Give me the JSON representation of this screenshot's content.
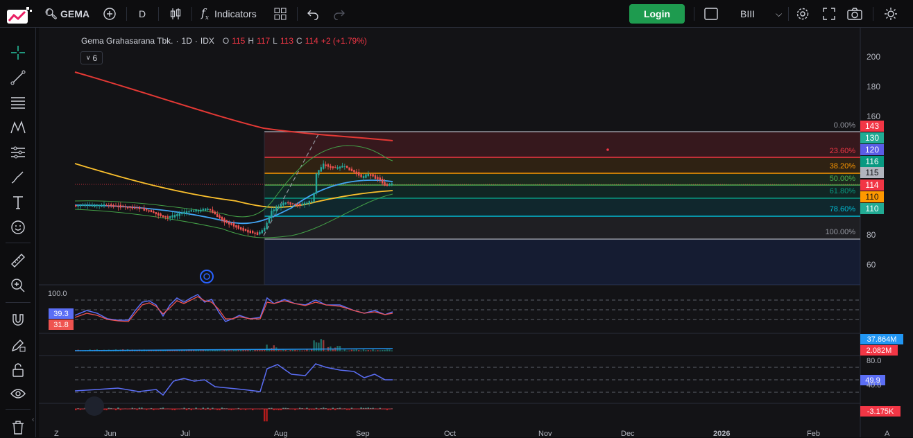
{
  "toolbar": {
    "symbol": "GEMA",
    "interval": "D",
    "indicators_label": "Indicators",
    "login_label": "Login",
    "broker_label": "BIII"
  },
  "legend": {
    "name": "Gema Grahasarana Tbk.",
    "interval": "1D",
    "exchange": "IDX",
    "o_label": "O",
    "o": "115",
    "h_label": "H",
    "h": "117",
    "l_label": "L",
    "l": "113",
    "c_label": "C",
    "c": "114",
    "change": "+2 (+1.79%)"
  },
  "indicator_count": "6",
  "price_axis": [
    "200",
    "180",
    "160",
    "80",
    "60"
  ],
  "fib_levels": [
    {
      "label": "0.00%",
      "color": "#9598a1"
    },
    {
      "label": "23.60%",
      "color": "#f23645"
    },
    {
      "label": "38.20%",
      "color": "#ff9800"
    },
    {
      "label": "50.00%",
      "color": "#4caf50"
    },
    {
      "label": "61.80%",
      "color": "#089981"
    },
    {
      "label": "78.60%",
      "color": "#00bcd4"
    },
    {
      "label": "100.00%",
      "color": "#9598a1"
    }
  ],
  "price_tags": [
    {
      "value": "143",
      "color": "#f23645"
    },
    {
      "value": "130",
      "color": "#22ab94"
    },
    {
      "value": "120",
      "color": "#5b5ce6"
    },
    {
      "value": "116",
      "color": "#089981"
    },
    {
      "value": "115",
      "color": "#b2b5be"
    },
    {
      "value": "114",
      "color": "#f23645"
    },
    {
      "value": "110",
      "color": "#ff9800"
    },
    {
      "value": "110",
      "color": "#22ab94"
    }
  ],
  "osc": {
    "top": "100.0",
    "k": "39.3",
    "d": "31.8"
  },
  "volume": {
    "v1": "37.864M",
    "v2": "2.082M"
  },
  "rsi": {
    "top": "80.0",
    "value": "49.9",
    "low": "40.0"
  },
  "macd": {
    "value": "-3.175K"
  },
  "time_axis": [
    "Z",
    "Jun",
    "Jul",
    "Aug",
    "Sep",
    "Oct",
    "Nov",
    "Dec",
    "2026",
    "Feb",
    "A"
  ],
  "colors": {
    "accent": "#1e9b4f",
    "bg": "#131316",
    "grid": "#2a2e39"
  }
}
